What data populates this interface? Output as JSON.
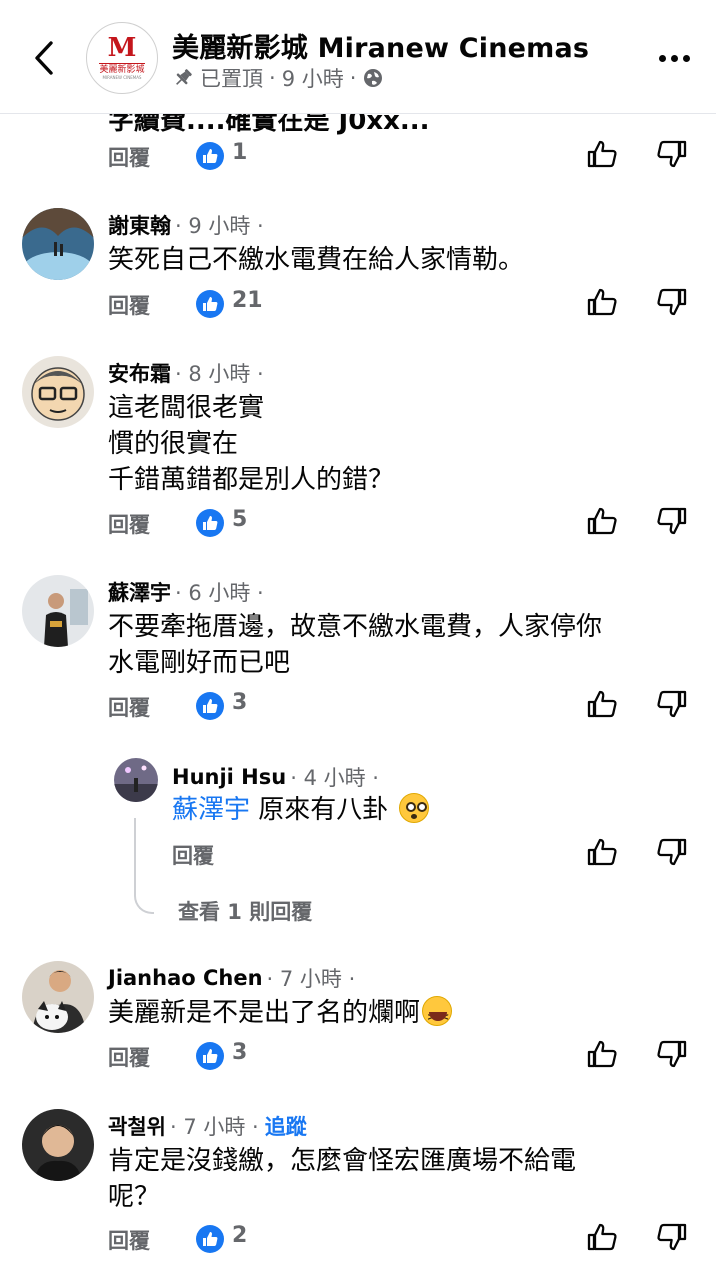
{
  "header": {
    "page_name": "美麗新影城 Miranew Cinemas",
    "logo_mark": "M",
    "logo_cn": "美麗新影城",
    "logo_en": "MIRANEW CINEMAS",
    "pinned_label": "已置頂",
    "time": "9 小時",
    "separator": "·",
    "icons": {
      "back": "chevron-left-icon",
      "pin": "pin-icon",
      "privacy": "globe-icon",
      "more": "more-dots-icon"
    }
  },
  "clipped_previous_text": "字續費....確實在是 J0xx...",
  "reply_label": "回覆",
  "colors": {
    "accent": "#1877f2",
    "secondary_text": "#65676b",
    "primary_text": "#050505"
  },
  "comments": [
    {
      "reply_label": "回覆",
      "likes": "1"
    },
    {
      "author": "謝東翰",
      "time": "· 9 小時 ·",
      "lines": [
        "笑死自己不繳水電費在給人家情勒。"
      ],
      "likes": "21"
    },
    {
      "author": "安布霜",
      "time": "· 8 小時 ·",
      "lines": [
        "這老闆很老實",
        "慣的很實在",
        "千錯萬錯都是別人的錯？"
      ],
      "likes": "5"
    },
    {
      "author": "蘇澤宇",
      "time": "· 6 小時 ·",
      "lines": [
        "不要牽拖厝邊，故意不繳水電費，人家停你",
        "水電剛好而已吧"
      ],
      "likes": "3"
    },
    {
      "author": "Jianhao Chen",
      "time": "· 7 小時 ·",
      "lines": [
        "美麗新是不是出了名的爛啊"
      ],
      "likes": "3"
    },
    {
      "author": "곽철위",
      "time": "· 7 小時 ·",
      "follow": "追蹤",
      "lines": [
        "肯定是沒錢繳，怎麼會怪宏匯廣場不給電",
        "呢？"
      ],
      "likes": "2"
    }
  ],
  "reply": {
    "author": "Hunji Hsu",
    "time": "· 4 小時 ·",
    "mention": "蘇澤宇",
    "text": " 原來有八卦",
    "reply_label": "回覆"
  },
  "view_replies": "查看 1 則回覆"
}
